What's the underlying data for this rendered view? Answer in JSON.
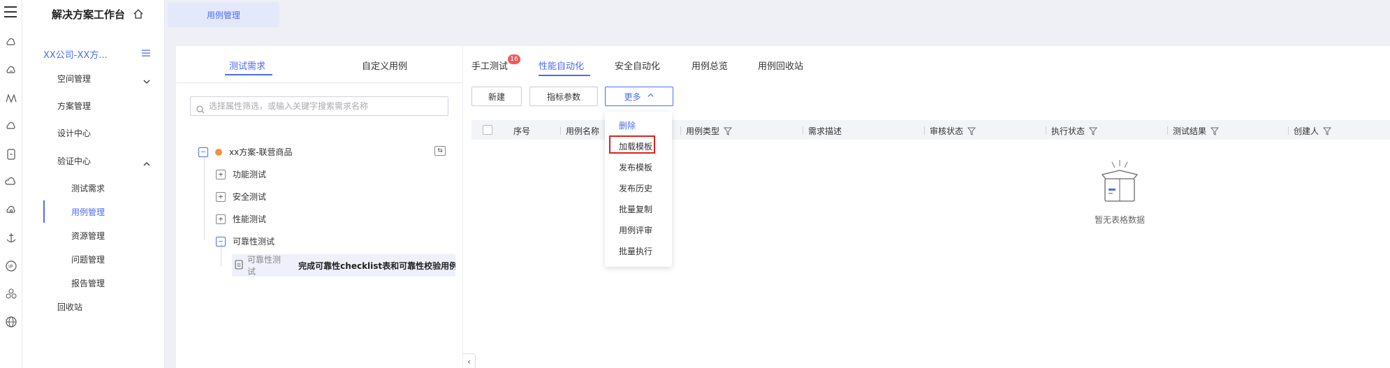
{
  "sidebar": {
    "brand": "解决方案工作台",
    "org": "XX公司-XX方...",
    "items": [
      {
        "label": "空间管理"
      },
      {
        "label": "方案管理"
      },
      {
        "label": "设计中心"
      },
      {
        "label": "验证中心"
      }
    ],
    "sub_items": [
      {
        "label": "测试需求"
      },
      {
        "label": "用例管理"
      },
      {
        "label": "资源管理"
      },
      {
        "label": "问题管理"
      },
      {
        "label": "报告管理"
      }
    ],
    "recycle": "回收站"
  },
  "top_tab": "用例管理",
  "tree_panel": {
    "tabs": [
      "测试需求",
      "自定义用例"
    ],
    "search_placeholder": "选择属性筛选，或输入关键字搜索需求名称",
    "root": "xx方案-联营商品",
    "nodes": [
      "功能测试",
      "安全测试",
      "性能测试",
      "可靠性测试"
    ],
    "leaf_tag": "可靠性测试",
    "leaf_title": "完成可靠性checklist表和可靠性校验用例"
  },
  "main": {
    "tabs": [
      "手工测试",
      "性能自动化",
      "安全自动化",
      "用例总览",
      "用例回收站"
    ],
    "badge": "16",
    "buttons": {
      "new": "新建",
      "params": "指标参数",
      "more": "更多"
    },
    "columns": [
      "序号",
      "用例名称",
      "用例类型",
      "需求描述",
      "审核状态",
      "执行状态",
      "测试结果",
      "创建人"
    ],
    "empty_text": "暂无表格数据"
  },
  "dropdown": {
    "items": [
      "删除",
      "加载模板",
      "发布模板",
      "发布历史",
      "批量复制",
      "用例评审",
      "批量执行"
    ]
  },
  "colors": {
    "accent": "#4a6cf7",
    "badge": "#f05a5a",
    "highlight": "#e02020"
  }
}
